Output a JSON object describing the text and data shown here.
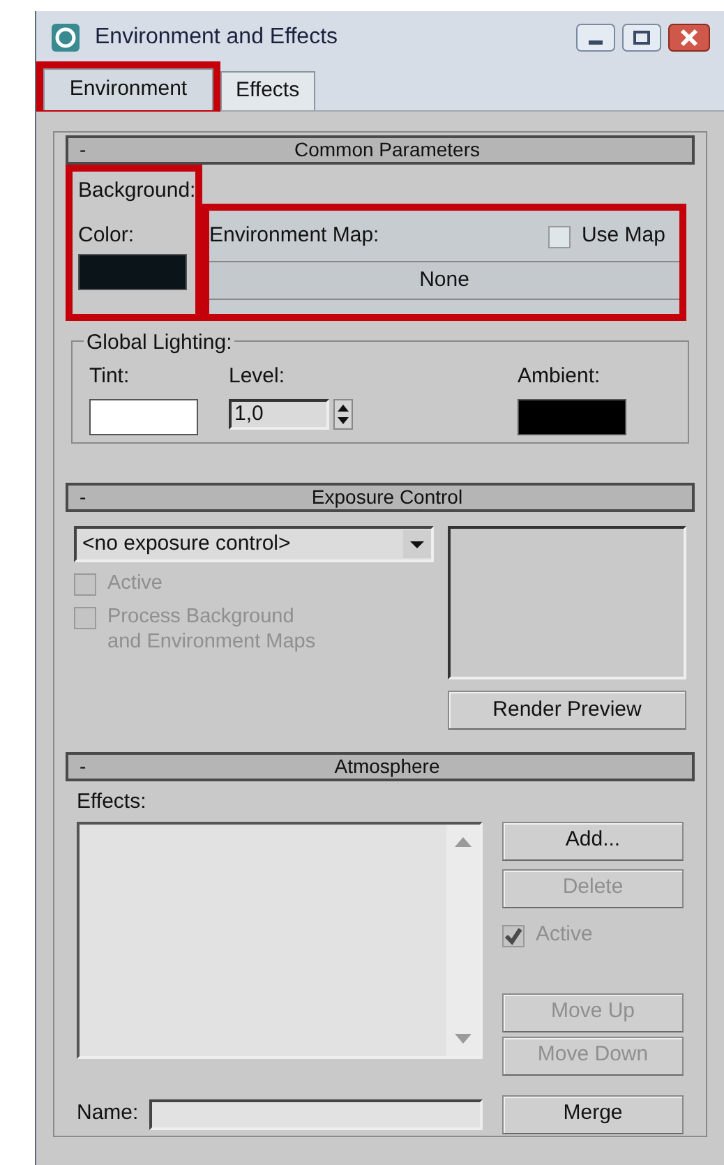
{
  "window": {
    "title": "Environment and Effects"
  },
  "tabs": [
    {
      "label": "Environment",
      "selected": true,
      "highlighted": true
    },
    {
      "label": "Effects",
      "selected": false,
      "highlighted": false
    }
  ],
  "common_parameters": {
    "collapse": "-",
    "title": "Common Parameters",
    "background": {
      "label": "Background:",
      "highlighted": true,
      "color_label": "Color:",
      "color": "#0b1418"
    },
    "environment_map": {
      "highlighted": true,
      "label": "Environment Map:",
      "use_map": {
        "label": "Use Map",
        "checked": false
      },
      "map_button": "None"
    },
    "global_lighting": {
      "label": "Global Lighting:",
      "tint": {
        "label": "Tint:",
        "color": "#ffffff"
      },
      "level": {
        "label": "Level:",
        "value": "1,0"
      },
      "ambient": {
        "label": "Ambient:",
        "color": "#000000"
      }
    }
  },
  "exposure_control": {
    "collapse": "-",
    "title": "Exposure Control",
    "dropdown": "<no exposure control>",
    "checkboxes": [
      {
        "label": "Active",
        "checked": false,
        "disabled": true
      },
      {
        "label": "Process Background and Environment Maps",
        "checked": false,
        "disabled": true
      }
    ],
    "render_preview": "Render Preview"
  },
  "atmosphere": {
    "collapse": "-",
    "title": "Atmosphere",
    "effects_label": "Effects:",
    "top_buttons": [
      {
        "label": "Add...",
        "disabled": false
      },
      {
        "label": "Delete",
        "disabled": true
      }
    ],
    "active": {
      "label": "Active",
      "checked": true,
      "disabled": true
    },
    "move_buttons": [
      {
        "label": "Move Up",
        "disabled": true
      },
      {
        "label": "Move Down",
        "disabled": true
      }
    ],
    "name_label": "Name:",
    "merge": {
      "label": "Merge",
      "disabled": false
    }
  }
}
